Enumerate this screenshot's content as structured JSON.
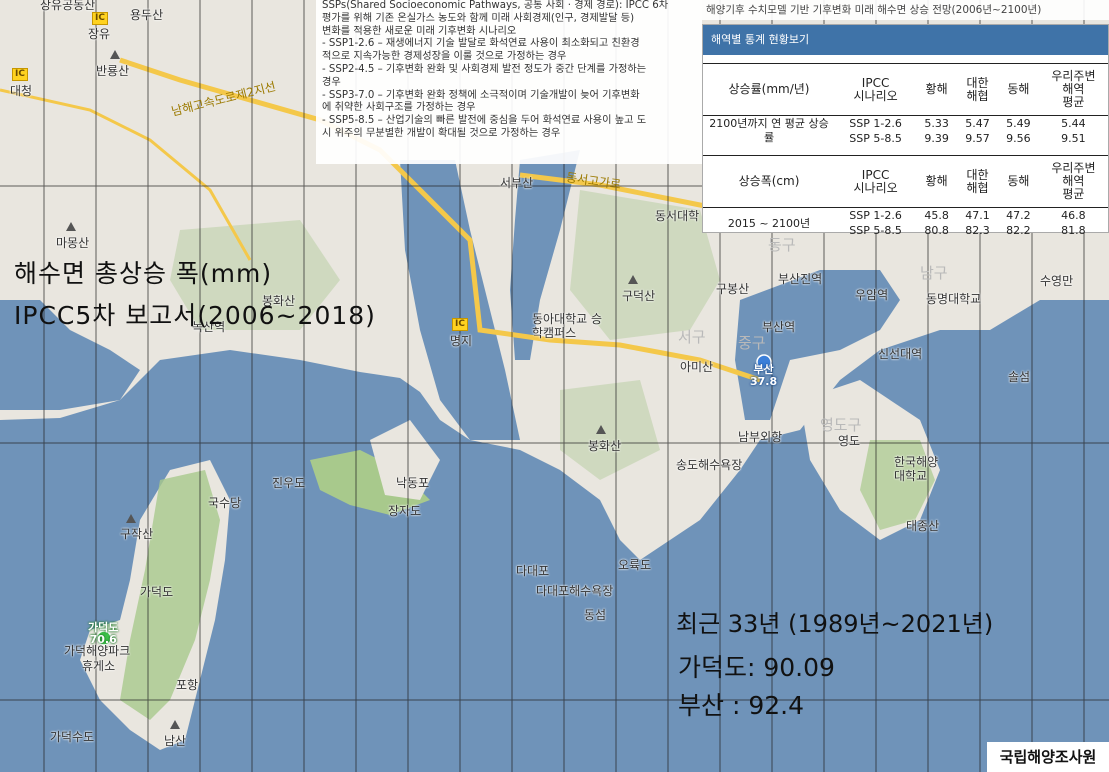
{
  "colors": {
    "sea": "#6f93b9",
    "land": "#e9e6df",
    "green": "#a8c98c",
    "road": "#f4c84a",
    "grid": "#222222",
    "panel_header": "#3f73a8"
  },
  "overlay_text": {
    "total_rise_title": "해수면 총상승 폭(mm)",
    "report_line": "IPCC5차 보고서(2006~2018)",
    "recent_title": "최근 33년 (1989년~2021년)",
    "gadeokdo_value": "가덕도: 90.09",
    "busan_value": "부산 : 92.4"
  },
  "ssp_box": {
    "lines": [
      "SSPs(Shared Socioeconomic Pathways, 공통 사회 · 경제 경로): IPCC 6차",
      "평가를 위해 기존 온실가스 농도와 함께 미래 사회경제(인구, 경제발달 등)",
      "변화를 적용한 새로운 미래 기후변화 시나리오",
      "- SSP1-2.6 – 재생에너지 기술 발달로 화석연료 사용이 최소화되고 친환경",
      "적으로 지속가능한 경제성장을 이룰 것으로 가정하는 경우",
      "- SSP2-4.5 – 기후변화 완화 및 사회경제 발전 정도가 중간 단계를 가정하는",
      "경우",
      "- SSP3-7.0 – 기후변화 완화 정책에 소극적이며 기술개발이 늦어 기후변화",
      "에 취약한 사회구조를 가정하는 경우",
      "- SSP5-8.5 – 산업기술의 빠른 발전에 중심을 두어 화석연료 사용이 높고 도",
      "시 위주의 무분별한 개발이 확대될 것으로 가정하는 경우"
    ]
  },
  "title_bar": "해양기후 수치모델 기반 기후변화 미래 해수면 상승 전망(2006년~2100년)",
  "stats_panel": {
    "header": "해역별 통계 현황보기",
    "rate_table": {
      "headers": [
        "상승률(mm/년)",
        "IPCC\n시나리오",
        "황해",
        "대한\n해협",
        "동해",
        "우리주변\n해역\n평균"
      ],
      "row_label": "2100년까지 연 평균 상승률",
      "rows": [
        [
          "SSP 1-2.6",
          "5.33",
          "5.47",
          "5.49",
          "5.44"
        ],
        [
          "SSP 5-8.5",
          "9.39",
          "9.57",
          "9.56",
          "9.51"
        ]
      ]
    },
    "width_table": {
      "headers": [
        "상승폭(cm)",
        "IPCC\n시나리오",
        "황해",
        "대한\n해협",
        "동해",
        "우리주변\n해역\n평균"
      ],
      "row_label": "2015 ~ 2100년",
      "rows": [
        [
          "SSP 1-2.6",
          "45.8",
          "47.1",
          "47.2",
          "46.8"
        ],
        [
          "SSP 5-8.5",
          "80.8",
          "82.3",
          "82.2",
          "81.8"
        ]
      ]
    }
  },
  "stations": [
    {
      "name": "부산",
      "value": "37.8"
    },
    {
      "name": "가덕도",
      "value": "70.6"
    }
  ],
  "credit": "국립해양조사원",
  "map_labels": {
    "places": [
      "상유공동산",
      "용두산",
      "장유",
      "반룡산",
      "대청",
      "마몽산",
      "봉화산",
      "녹산역",
      "명지",
      "동아대학교 승학캠퍼스",
      "서부산",
      "동서대학",
      "구덕산",
      "구봉산",
      "부산진역",
      "우암역",
      "동명대학교",
      "수영만",
      "부산역",
      "신선대역",
      "아미산",
      "부산",
      "남부외항",
      "영도",
      "한국해양대학교",
      "태종산",
      "봉화산",
      "송도해수욕장",
      "진우도",
      "낙동포",
      "장자도",
      "국수당",
      "구작산",
      "다대포",
      "다대포해수욕장",
      "가덕도",
      "가덕해양파크",
      "휴게소",
      "포항",
      "남산",
      "가덕수도",
      "동섬",
      "오륙도",
      "솔섬"
    ],
    "districts": [
      "서구",
      "중구",
      "동구",
      "남구",
      "영도구"
    ],
    "roads": [
      "남해고속도로제2지선",
      "동서고가로"
    ],
    "ic_label": "IC"
  }
}
